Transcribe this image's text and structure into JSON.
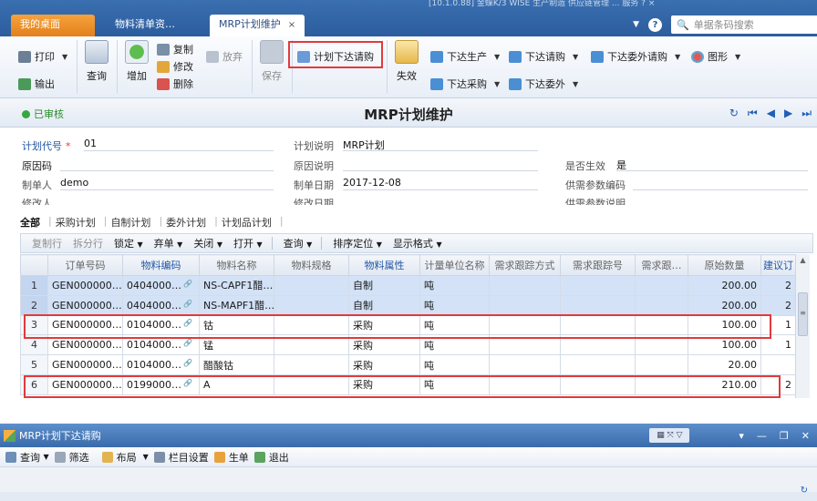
{
  "system_strip": "[10.1.0.88] 金蝶K/3 WISE 生产制造 供应链管理 ... 服务 ? ×",
  "tabs": [
    {
      "label": "我的桌面"
    },
    {
      "label": "物料清单资…"
    },
    {
      "label": "MRP计划维护",
      "close": "×"
    }
  ],
  "top_right": {
    "dropdown": "▼",
    "help": "?",
    "search_placeholder": "单据条码搜索",
    "search_icon": "🔍"
  },
  "ribbon": {
    "print": "打印",
    "output": "输出",
    "query": "查询",
    "add": "增加",
    "copy": "复制",
    "modify": "修改",
    "delete": "删除",
    "abandon": "放弃",
    "save": "保存",
    "plan_issue_request": "计划下达请购",
    "invalidate": "失效",
    "issue_production": "下达生产",
    "issue_request": "下达请购",
    "issue_outsource_request": "下达委外请购",
    "graph": "图形",
    "issue_purchase": "下达采购",
    "issue_outsource": "下达委外",
    "arrow": "▼"
  },
  "status": {
    "approved": "已审核",
    "page_title": "MRP计划维护",
    "nav": [
      "↻",
      "⏮",
      "◀",
      "▶",
      "⏭"
    ]
  },
  "form": {
    "plan_code_label": "计划代号",
    "required_mark": "*",
    "plan_code": "01",
    "plan_desc_label": "计划说明",
    "plan_desc": "MRP计划",
    "reason_label": "原因码",
    "reason_desc_label": "原因说明",
    "effective_label": "是否生效",
    "effective": "是",
    "creator_label": "制单人",
    "creator": "demo",
    "create_date_label": "制单日期",
    "create_date": "2017-12-08",
    "supply_param_code_label": "供需参数编码",
    "modifier_label": "修改人",
    "modify_date_label": "修改日期",
    "supply_param_desc_label": "供需参数说明"
  },
  "subtabs": [
    "全部",
    "采购计划",
    "自制计划",
    "委外计划",
    "计划品计划"
  ],
  "gridbar": {
    "copy_row": "复制行",
    "split_row": "拆分行",
    "lock": "锁定",
    "abandon": "弃单",
    "close": "关闭",
    "open": "打开",
    "query": "查询",
    "sort": "排序定位",
    "display_format": "显示格式",
    "arrow": "▼"
  },
  "columns": [
    "订单号码",
    "物料编码",
    "物料名称",
    "物料规格",
    "物料属性",
    "计量单位名称",
    "需求跟踪方式",
    "需求跟踪号",
    "需求跟…",
    "原始数量",
    "建议订"
  ],
  "rows": [
    {
      "no": "1",
      "order": "GEN000000…",
      "code": "0404000…",
      "name": "NS-CAPF1醋…",
      "spec": "",
      "attr": "自制",
      "unit": "吨",
      "qty": "200.00",
      "sug": "2"
    },
    {
      "no": "2",
      "order": "GEN000000…",
      "code": "0404000…",
      "name": "NS-MAPF1醋…",
      "spec": "",
      "attr": "自制",
      "unit": "吨",
      "qty": "200.00",
      "sug": "2"
    },
    {
      "no": "3",
      "order": "GEN000000…",
      "code": "0104000…",
      "name": "钴",
      "spec": "",
      "attr": "采购",
      "unit": "吨",
      "qty": "100.00",
      "sug": "1"
    },
    {
      "no": "4",
      "order": "GEN000000…",
      "code": "0104000…",
      "name": "锰",
      "spec": "",
      "attr": "采购",
      "unit": "吨",
      "qty": "100.00",
      "sug": "1"
    },
    {
      "no": "5",
      "order": "GEN000000…",
      "code": "0104000…",
      "name": "醋酸钴",
      "spec": "",
      "attr": "采购",
      "unit": "吨",
      "qty": "20.00",
      "sug": ""
    },
    {
      "no": "6",
      "order": "GEN000000…",
      "code": "0199000…",
      "name": "A",
      "spec": "",
      "attr": "采购",
      "unit": "吨",
      "qty": "210.00",
      "sug": "2"
    }
  ],
  "subwindow": {
    "title": "MRP计划下达请购",
    "controls": [
      "▾",
      "—",
      "❐",
      "✕"
    ],
    "layout_label": "▦ ⤧ ▽",
    "tools": {
      "query": "查询",
      "filter": "筛选",
      "layout": "布局",
      "column_settings": "栏目设置",
      "generate": "生单",
      "exit": "退出",
      "arrow": "▼"
    },
    "corner": "↻"
  },
  "colors": {
    "accent": "#2c5d9e",
    "highlight_red": "#e23a3a",
    "tab_orange": "#f0962e",
    "approved_green": "#39a73f"
  }
}
